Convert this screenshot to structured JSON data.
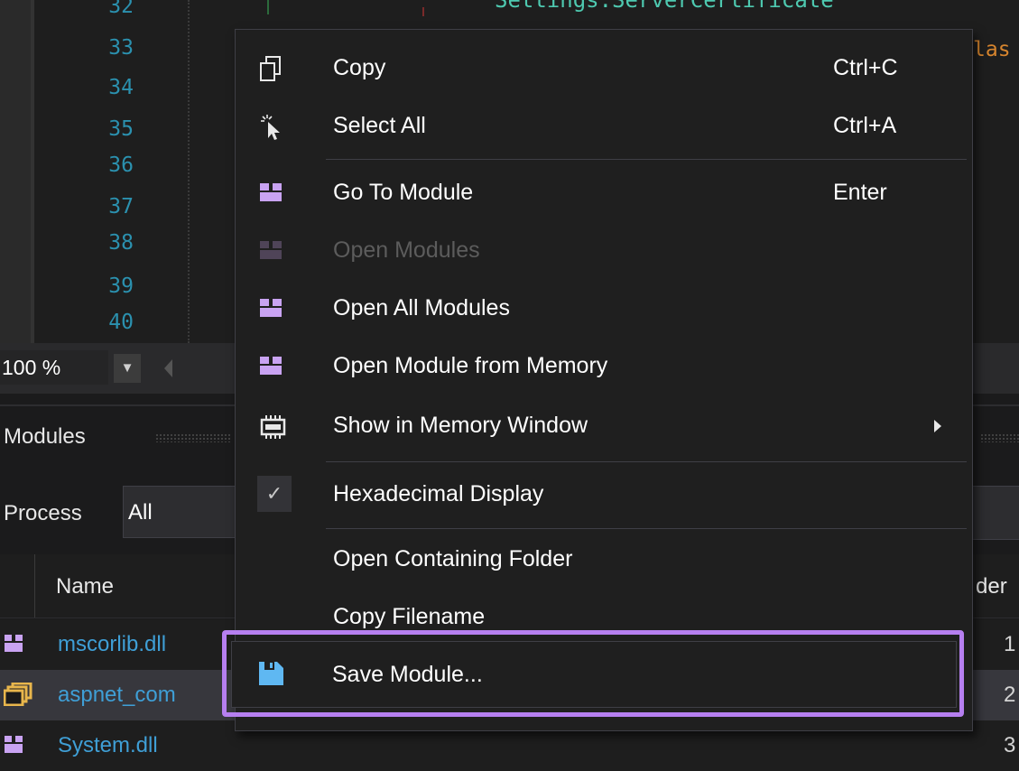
{
  "editor": {
    "line_numbers": [
      "32",
      "33",
      "34",
      "35",
      "36",
      "37",
      "38",
      "39",
      "40"
    ],
    "code_top_text": "Settings.ServerCertificate",
    "code_keyword_fragment": "las",
    "zoom_level": "100 %"
  },
  "modules_panel": {
    "title": "Modules",
    "process_label": "Process",
    "process_value": "All",
    "columns": {
      "name": "Name",
      "order": "der"
    },
    "rows": [
      {
        "name": "mscorlib.dll",
        "order": "1"
      },
      {
        "name": "aspnet_com",
        "order": "2"
      },
      {
        "name": "System.dll",
        "order": "3"
      }
    ]
  },
  "context_menu": {
    "items": [
      {
        "label": "Copy",
        "shortcut": "Ctrl+C",
        "icon": "copy-icon",
        "enabled": true
      },
      {
        "label": "Select All",
        "shortcut": "Ctrl+A",
        "icon": "select-all-icon",
        "enabled": true
      },
      {
        "label": "Go To Module",
        "shortcut": "Enter",
        "icon": "module-icon",
        "enabled": true
      },
      {
        "label": "Open Modules",
        "shortcut": "",
        "icon": "module-icon",
        "enabled": false
      },
      {
        "label": "Open All Modules",
        "shortcut": "",
        "icon": "module-icon",
        "enabled": true
      },
      {
        "label": "Open Module from Memory",
        "shortcut": "",
        "icon": "module-icon",
        "enabled": true
      },
      {
        "label": "Show in Memory Window",
        "shortcut": "",
        "icon": "memory-chip-icon",
        "enabled": true,
        "submenu": true
      },
      {
        "label": "Hexadecimal Display",
        "shortcut": "",
        "icon": "checkmark-icon",
        "enabled": true,
        "checked": true
      },
      {
        "label": "Open Containing Folder",
        "shortcut": "",
        "icon": "",
        "enabled": true
      },
      {
        "label": "Copy Filename",
        "shortcut": "",
        "icon": "",
        "enabled": true
      },
      {
        "label": "Save Module...",
        "shortcut": "",
        "icon": "save-icon",
        "enabled": true,
        "highlighted": true
      }
    ]
  },
  "colors": {
    "menu_background": "#1f1f1f",
    "module_icon": "#c9a3f2",
    "save_icon": "#5fb8f2",
    "highlight_border": "#b67ff0",
    "line_number": "#2b91af",
    "link_text": "#3f9fd6"
  }
}
